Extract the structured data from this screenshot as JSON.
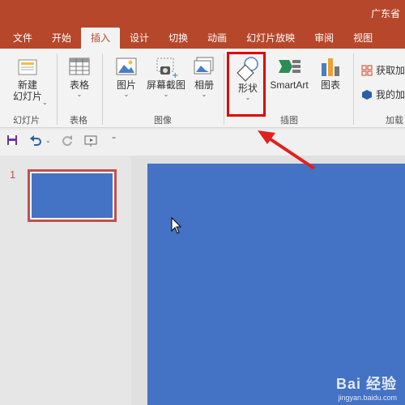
{
  "window": {
    "title": "广东省"
  },
  "tabs": [
    {
      "label": "文件"
    },
    {
      "label": "开始"
    },
    {
      "label": "插入"
    },
    {
      "label": "设计"
    },
    {
      "label": "切换"
    },
    {
      "label": "动画"
    },
    {
      "label": "幻灯片放映"
    },
    {
      "label": "审阅"
    },
    {
      "label": "视图"
    }
  ],
  "ribbon": {
    "new_slide": {
      "line1": "新建",
      "line2": "幻灯片"
    },
    "table": {
      "label": "表格"
    },
    "picture": {
      "label": "图片"
    },
    "screenshot": {
      "label": "屏幕截图"
    },
    "album": {
      "label": "相册"
    },
    "shapes": {
      "label": "形状"
    },
    "smartart": {
      "label": "SmartArt"
    },
    "chart": {
      "label": "图表"
    },
    "get_addins": {
      "label": "获取加"
    },
    "my_addins": {
      "label": "我的加"
    },
    "groups": {
      "slides": "幻灯片",
      "tables": "表格",
      "images": "图像",
      "illustrations": "插图",
      "addins": "加载"
    }
  },
  "thumbnails": [
    {
      "number": "1"
    }
  ],
  "watermark": {
    "brand": "Bai 经验",
    "url": "jingyan.baidu.com"
  },
  "colors": {
    "accent": "#b7472a",
    "slide": "#4472c4",
    "highlight": "#e00000"
  }
}
